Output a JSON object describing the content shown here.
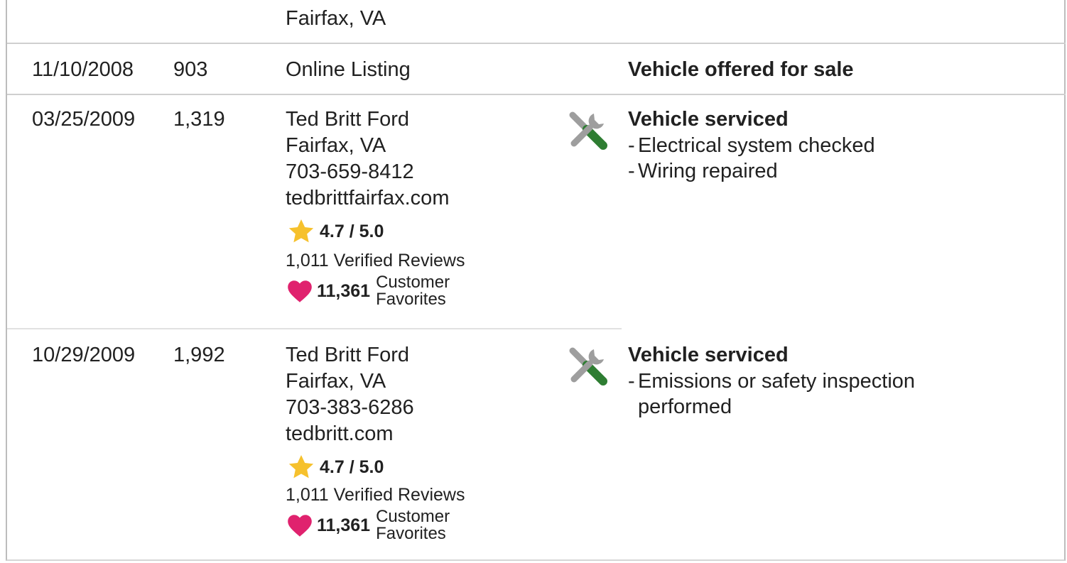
{
  "rows": [
    {
      "location": "Fairfax, VA"
    },
    {
      "date": "11/10/2008",
      "mileage": "903",
      "source": "Online Listing",
      "event_title": "Vehicle offered for sale"
    },
    {
      "date": "03/25/2009",
      "mileage": "1,319",
      "dealer_name": "Ted Britt Ford",
      "dealer_location": "Fairfax, VA",
      "dealer_phone": "703-659-8412",
      "dealer_website": "tedbrittfairfax.com",
      "rating": "4.7 / 5.0",
      "reviews": "1,011 Verified Reviews",
      "favorites_count": "11,361",
      "favorites_label_1": "Customer",
      "favorites_label_2": "Favorites",
      "event_title": "Vehicle serviced",
      "details": [
        "Electrical system checked",
        "Wiring repaired"
      ],
      "event_icon": "service-tools-icon"
    },
    {
      "date": "10/29/2009",
      "mileage": "1,992",
      "dealer_name": "Ted Britt Ford",
      "dealer_location": "Fairfax, VA",
      "dealer_phone": "703-383-6286",
      "dealer_website": "tedbritt.com",
      "rating": "4.7 / 5.0",
      "reviews": "1,011 Verified Reviews",
      "favorites_count": "11,361",
      "favorites_label_1": "Customer",
      "favorites_label_2": "Favorites",
      "event_title": "Vehicle serviced",
      "details_line1": "Emissions or safety inspection",
      "details_line2": "performed",
      "event_icon": "service-tools-icon"
    }
  ],
  "colors": {
    "star": "#f6c12d",
    "heart": "#e0226e",
    "tool_gray": "#9e9e9e",
    "tool_green": "#2e7d32"
  },
  "icons": [
    "star-icon",
    "heart-icon",
    "service-tools-icon"
  ]
}
